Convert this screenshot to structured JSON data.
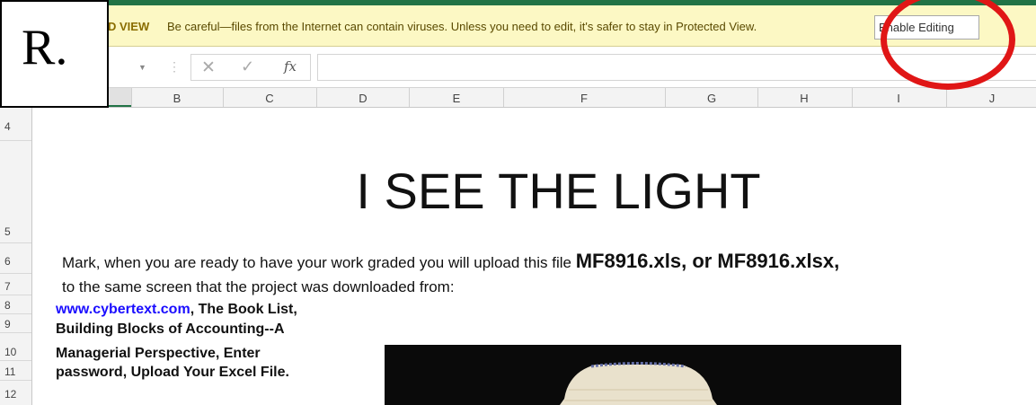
{
  "protected_view": {
    "title_fragment": "D VIEW",
    "message": "Be careful—files from the Internet can contain viruses. Unless you need to edit, it's safer to stay in Protected View.",
    "enable_button": "Enable Editing"
  },
  "overlay_label": "R.",
  "formula_bar": {
    "cancel_icon": "✕",
    "enter_icon": "✓",
    "fx_label": "fx"
  },
  "columns": [
    "B",
    "C",
    "D",
    "E",
    "F",
    "G",
    "H",
    "I",
    "J"
  ],
  "rows": [
    "4",
    "5",
    "6",
    "7",
    "8",
    "9",
    "10",
    "11",
    "12"
  ],
  "sheet": {
    "title": "I SEE THE LIGHT",
    "line6_prefix": "Mark, when you are ready to have your work graded you will upload this file ",
    "line6_file": "MF8916.xls, or MF8916.xlsx,",
    "line7": "to the same screen that the project was downloaded from:",
    "link": "www.cybertext.com",
    "line8_rest": ", The Book List,",
    "line9": "Building Blocks of Accounting--A",
    "line10": "Managerial Perspective, Enter",
    "line11": "password, Upload Your Excel File."
  },
  "colors": {
    "accent": "#217346",
    "highlight_circle": "#e01616",
    "link": "#1a0dff"
  }
}
